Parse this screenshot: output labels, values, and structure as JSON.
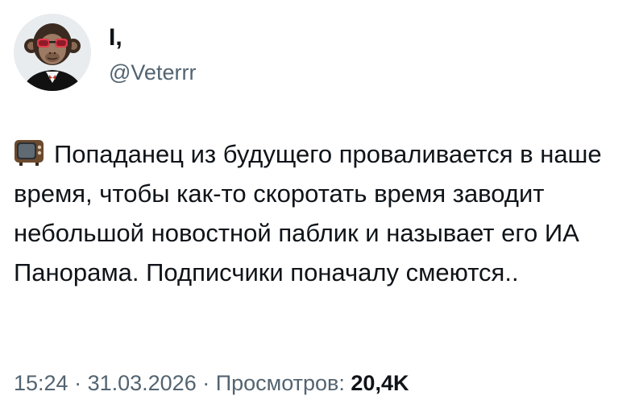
{
  "author": {
    "display_name": "І,",
    "handle": "@Veterrr",
    "avatar_icon": "monkey-with-sunglasses-avatar"
  },
  "tweet": {
    "emoji_icon": "television-icon",
    "text": "Попаданец из будущего проваливается в наше время, чтобы как-то скоротать время заводит небольшой новостной паблик и называет его ИА Панорама. Подписчики поначалу смеются.."
  },
  "meta": {
    "time": "15:24",
    "separator": " · ",
    "date": "31.03.2026",
    "views_label": "Просмотров:",
    "views_count": "20,4K"
  },
  "colors": {
    "text_primary": "#0f1419",
    "text_secondary": "#536471",
    "background": "#ffffff"
  }
}
